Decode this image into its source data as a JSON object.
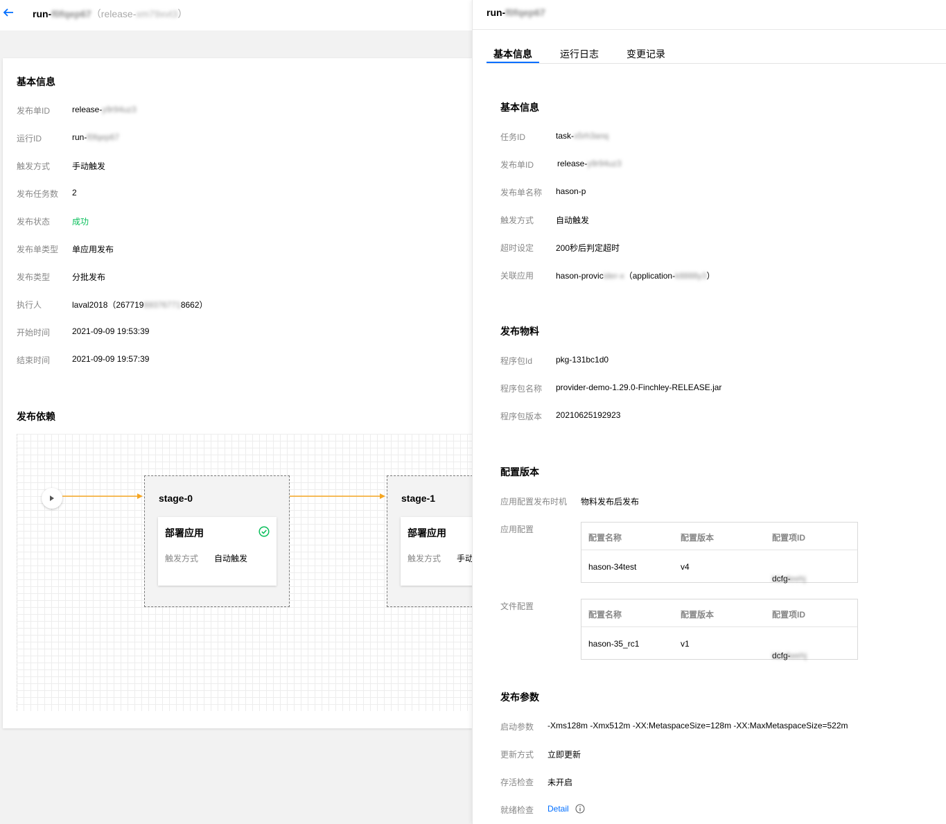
{
  "header": {
    "run_name": "run-",
    "run_blur": "f0fqep67",
    "release_open": "（release-",
    "release_blur": "xm79xvt3",
    "release_close": "）"
  },
  "basic": {
    "title": "基本信息",
    "rows": [
      {
        "label": "发布单ID",
        "value": "release-",
        "blur": "y9r94uz3"
      },
      {
        "label": "运行ID",
        "value": "run-",
        "blur": "f0fqep67"
      },
      {
        "label": "触发方式",
        "value": "手动触发"
      },
      {
        "label": "发布任务数",
        "value": "2"
      },
      {
        "label": "发布状态",
        "value": "成功"
      },
      {
        "label": "发布单类型",
        "value": "单应用发布"
      },
      {
        "label": "发布类型",
        "value": "分批发布"
      },
      {
        "label": "执行人",
        "value": "laval2018（267719",
        "blur": "69376771",
        "value_tail": "8662）"
      },
      {
        "label": "开始时间",
        "value": "2021-09-09 19:53:39"
      },
      {
        "label": "结束时间",
        "value": "2021-09-09 19:57:39"
      }
    ]
  },
  "dependency": {
    "title": "发布依赖",
    "stages": [
      {
        "name": "stage-0",
        "task_title": "部署应用",
        "trigger_label": "触发方式",
        "trigger_value": "自动触发"
      },
      {
        "name": "stage-1",
        "task_title": "部署应用",
        "trigger_label": "触发方式",
        "trigger_value": "手动触发"
      }
    ],
    "colors": {
      "arrow": "#f5a623",
      "success": "#0abf5b"
    }
  },
  "drawer": {
    "title": "run-",
    "title_blur": "f0fqep67",
    "tabs": [
      "基本信息",
      "运行日志",
      "变更记录"
    ],
    "active_tab": 0,
    "basic": {
      "title": "基本信息",
      "rows": [
        {
          "label": "任务ID",
          "value": "task-",
          "blur": "x5rh3anq"
        },
        {
          "label": "发布单ID",
          "value": "release-",
          "blur": "y9r94uz3"
        },
        {
          "label": "发布单名称",
          "value": "hason-p"
        },
        {
          "label": "触发方式",
          "value": "自动触发"
        },
        {
          "label": "超时设定",
          "value": "200秒后判定超时"
        },
        {
          "label": "关联应用",
          "value": "hason-provic",
          "blur": "ider-x",
          "value_mid": "（application-",
          "blur2": "k8888y3",
          "value_tail": "）"
        }
      ]
    },
    "material": {
      "title": "发布物料",
      "rows": [
        {
          "label": "程序包Id",
          "value": "pkg-131bc1d0"
        },
        {
          "label": "程序包名称",
          "value": "provider-demo-1.29.0-Finchley-RELEASE.jar"
        },
        {
          "label": "程序包版本",
          "value": "20210625192923"
        }
      ]
    },
    "config": {
      "title": "配置版本",
      "timing_label": "应用配置发布时机",
      "timing_value": "物料发布后发布",
      "app_label": "应用配置",
      "file_label": "文件配置",
      "columns": [
        "配置名称",
        "配置版本",
        "配置项ID"
      ],
      "app_rows": [
        {
          "name": "hason-34test",
          "version": "v4",
          "id": "dcfg-",
          "id_blur": "h1x4eehj"
        }
      ],
      "file_rows": [
        {
          "name": "hason-35_rc1",
          "version": "v1",
          "id": "dcfg-",
          "id_blur": "k1x4wehj"
        }
      ]
    },
    "params": {
      "title": "发布参数",
      "rows": [
        {
          "label": "启动参数",
          "value": "-Xms128m -Xmx512m -XX:MetaspaceSize=128m -XX:MaxMetaspaceSize=522m"
        },
        {
          "label": "更新方式",
          "value": "立即更新"
        },
        {
          "label": "存活检查",
          "value": "未开启"
        },
        {
          "label": "就绪检查",
          "value": "Detail"
        }
      ]
    }
  }
}
